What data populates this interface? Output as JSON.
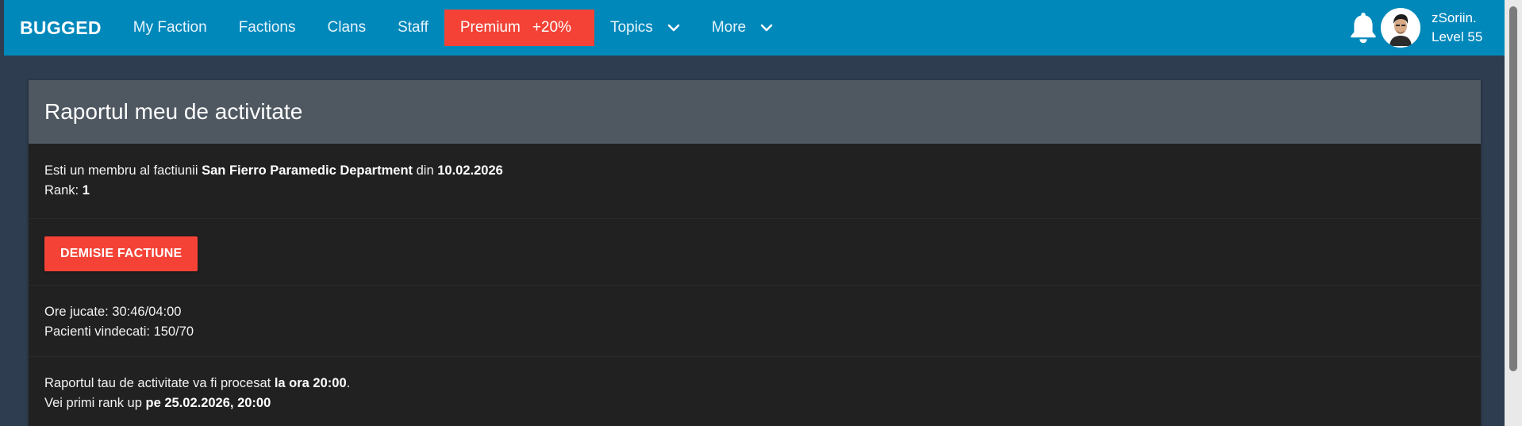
{
  "navbar": {
    "brand": "BUGGED",
    "items": [
      "My Faction",
      "Factions",
      "Clans",
      "Staff"
    ],
    "premium_label": "Premium",
    "premium_bonus": "+20%",
    "topics_label": "Topics",
    "more_label": "More",
    "user_name": "zSoriin.",
    "user_level": "Level 55",
    "icons": [
      "bell-icon",
      "chevron-down-icon",
      "avatar"
    ]
  },
  "colors": {
    "navbar": "#0088bb",
    "premium": "#f44336",
    "background": "#2e3d4f",
    "card": "#212121",
    "card_header": "#4f5861"
  },
  "card": {
    "title": "Raportul meu de activitate",
    "membership": {
      "prefix": "Esti un membru al factiunii ",
      "faction": "San Fierro Paramedic Department",
      "since_word": " din ",
      "date": "10.02.2026",
      "rank_label": "Rank: ",
      "rank_value": "1"
    },
    "resign_button": "DEMISIE FACTIUNE",
    "stats": {
      "hours": "Ore jucate: 30:46/04:00",
      "patients": "Pacienti vindecati: 150/70"
    },
    "report": {
      "line1_prefix": "Raportul tau de activitate va fi procesat ",
      "line1_bold": "la ora 20:00",
      "line1_suffix": ".",
      "line2_prefix": "Vei primi rank up ",
      "line2_bold": "pe 25.02.2026, 20:00"
    }
  }
}
